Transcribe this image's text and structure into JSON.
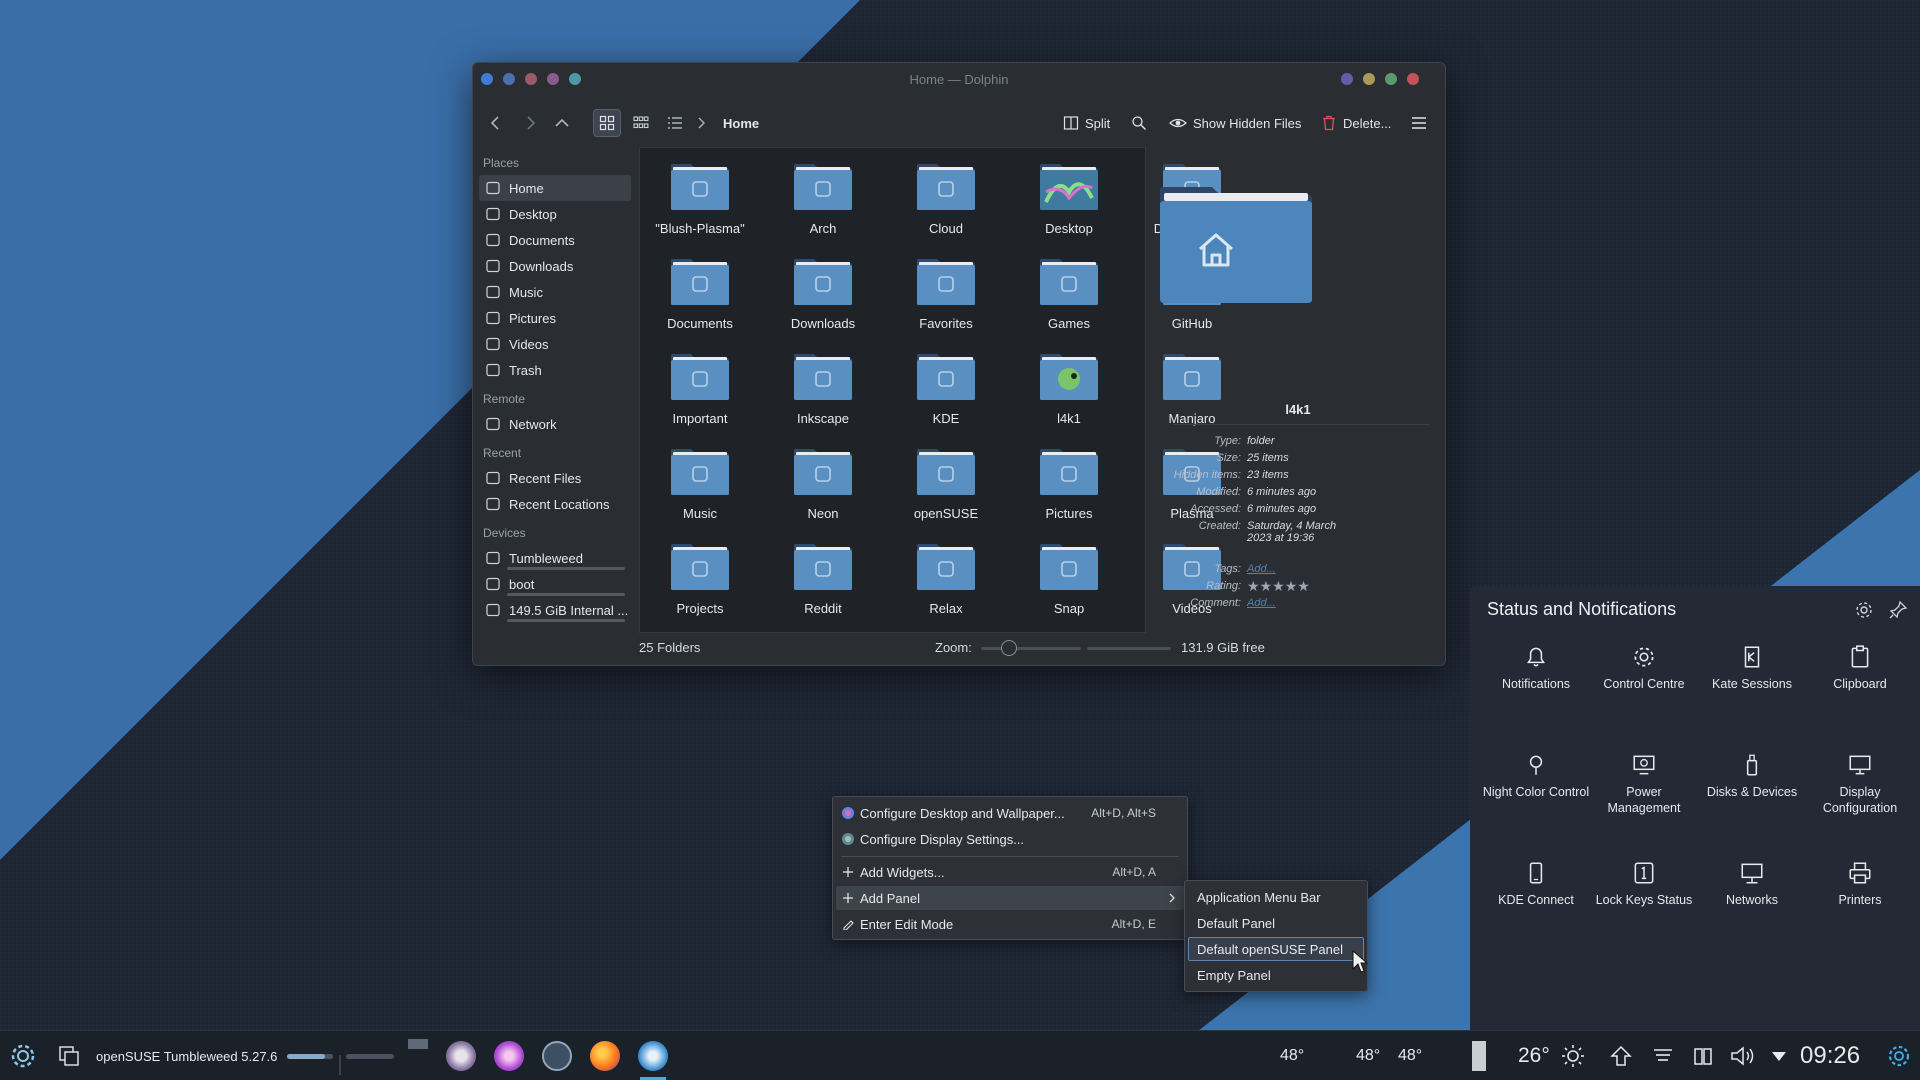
{
  "window": {
    "title": "Home — Dolphin",
    "breadcrumb": "Home",
    "split_label": "Split",
    "hidden_files_label": "Show Hidden Files",
    "delete_label": "Delete..."
  },
  "sidebar": {
    "sections": [
      {
        "title": "Places",
        "items": [
          {
            "label": "Home",
            "icon": "home-icon"
          },
          {
            "label": "Desktop",
            "icon": "desktop-icon"
          },
          {
            "label": "Documents",
            "icon": "documents-icon"
          },
          {
            "label": "Downloads",
            "icon": "downloads-icon"
          },
          {
            "label": "Music",
            "icon": "music-icon"
          },
          {
            "label": "Pictures",
            "icon": "pictures-icon"
          },
          {
            "label": "Videos",
            "icon": "videos-icon"
          },
          {
            "label": "Trash",
            "icon": "trash-icon"
          }
        ]
      },
      {
        "title": "Remote",
        "items": [
          {
            "label": "Network",
            "icon": "network-icon"
          }
        ]
      },
      {
        "title": "Recent",
        "items": [
          {
            "label": "Recent Files",
            "icon": "recent-files-icon"
          },
          {
            "label": "Recent Locations",
            "icon": "recent-locations-icon"
          }
        ]
      },
      {
        "title": "Devices",
        "items": [
          {
            "label": "Tumbleweed",
            "icon": "drive-icon"
          },
          {
            "label": "boot",
            "icon": "drive-icon"
          },
          {
            "label": "149.5 GiB Internal ...",
            "icon": "drive-icon"
          }
        ]
      }
    ]
  },
  "folders": [
    "\"Blush-Plasma\"",
    "Arch",
    "Cloud",
    "Desktop",
    "Development",
    "Documents",
    "Downloads",
    "Favorites",
    "Games",
    "GitHub",
    "Important",
    "Inkscape",
    "KDE",
    "l4k1",
    "Manjaro",
    "Music",
    "Neon",
    "openSUSE",
    "Pictures",
    "Plasma",
    "Projects",
    "Reddit",
    "Relax",
    "Snap",
    "Videos"
  ],
  "info": {
    "name": "l4k1",
    "type_label": "Type:",
    "type": "folder",
    "size_label": "Size:",
    "size": "25 items",
    "hidden_label": "Hidden items:",
    "hidden": "23 items",
    "modified_label": "Modified:",
    "modified": "6 minutes ago",
    "accessed_label": "Accessed:",
    "accessed": "6 minutes ago",
    "created_label": "Created:",
    "created": "Saturday, 4 March 2023 at 19:36",
    "tags_label": "Tags:",
    "tags": "Add...",
    "rating_label": "Rating:",
    "rating": 0,
    "comment_label": "Comment:",
    "comment": "Add..."
  },
  "status": {
    "folders_count": "25 Folders",
    "zoom_label": "Zoom:",
    "zoom_level": 0.25,
    "free_space": "131.9 GiB free"
  },
  "notifications_panel": {
    "title": "Status and Notifications",
    "items": [
      {
        "label": "Notifications",
        "icon": "bell-icon"
      },
      {
        "label": "Control Centre",
        "icon": "gear-icon"
      },
      {
        "label": "Kate Sessions",
        "icon": "kate-icon"
      },
      {
        "label": "Clipboard",
        "icon": "clipboard-icon"
      },
      {
        "label": "Night Color Control",
        "icon": "lightbulb-icon"
      },
      {
        "label": "Power Management",
        "icon": "power-monitor-icon"
      },
      {
        "label": "Disks & Devices",
        "icon": "usb-drive-icon"
      },
      {
        "label": "Display Configuration",
        "icon": "display-icon"
      },
      {
        "label": "KDE Connect",
        "icon": "phone-icon"
      },
      {
        "label": "Lock Keys Status",
        "icon": "lock-keys-icon"
      },
      {
        "label": "Networks",
        "icon": "network-monitor-icon"
      },
      {
        "label": "Printers",
        "icon": "printer-icon"
      }
    ]
  },
  "context_menu": {
    "items": [
      {
        "label": "Configure Desktop and Wallpaper...",
        "shortcut": "Alt+D, Alt+S"
      },
      {
        "label": "Configure Display Settings...",
        "shortcut": ""
      },
      {
        "label": "Add Widgets...",
        "shortcut": "Alt+D, A"
      },
      {
        "label": "Add Panel",
        "shortcut": ""
      },
      {
        "label": "Enter Edit Mode",
        "shortcut": "Alt+D, E"
      }
    ],
    "submenu": [
      "Application Menu Bar",
      "Default Panel",
      "Default openSUSE Panel",
      "Empty Panel"
    ]
  },
  "taskbar": {
    "activity_label": "openSUSE Tumbleweed 5.27.6",
    "temps": [
      "48°",
      "48°",
      "48°"
    ],
    "weather": "26°",
    "clock": "09:26"
  },
  "colors": {
    "accent": "#3daee9",
    "folder_blue": "#5b8dbf",
    "panel_bg": "#232a35",
    "taskbar_bg": "#1b2129"
  }
}
